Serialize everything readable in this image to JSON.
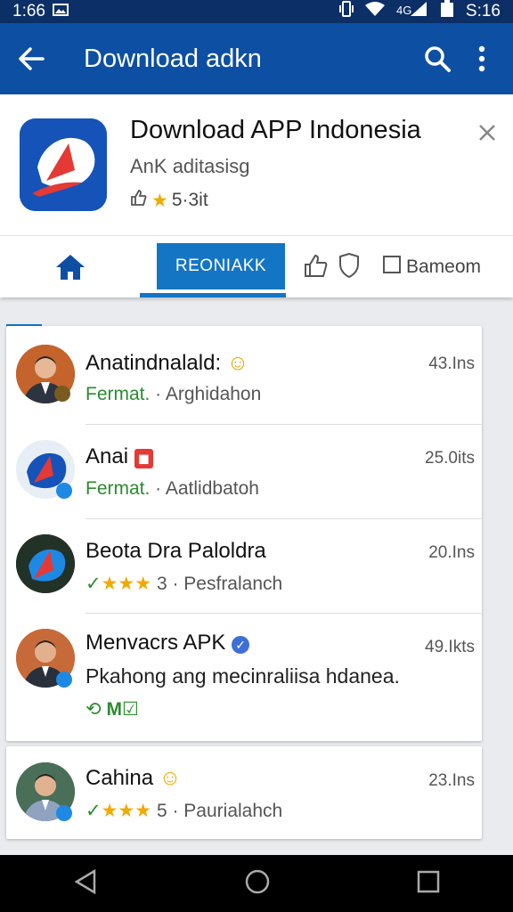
{
  "status": {
    "time": "1:66",
    "right_text": "S:16"
  },
  "appbar": {
    "title": "Download adkn"
  },
  "app": {
    "name": "Download APP Indonesia",
    "subtitle": "AnK aditasisg",
    "rating": "5·3it"
  },
  "tabs": {
    "reco": "REONIAKK",
    "bameom": "Bameom"
  },
  "list": [
    {
      "name": "Anatindnalald:",
      "meta_green": "Fermat.",
      "meta": "Arghidahon",
      "time": "43.Ins"
    },
    {
      "name": "Anai",
      "meta_green": "Fermat.",
      "meta": "Aatlidbatoh",
      "time": "25.0its"
    },
    {
      "name": "Beota Dra Paloldra",
      "stars": "★★★",
      "count": "3",
      "meta": "Pesfralanch",
      "time": "20.Ins"
    },
    {
      "name": "Menvacrs APK",
      "desc": "Pkahong ang mecinraliisa hdanea.",
      "tags": "M",
      "time": "49.Ikts"
    },
    {
      "name": "Cahina",
      "stars": "★★★",
      "count": "5",
      "meta": "Paurialahch",
      "time": "23.Ins"
    }
  ],
  "colors": {
    "primary": "#0d4fa3",
    "accent": "#1475c5",
    "green": "#2c8b2e",
    "star": "#f2a900"
  }
}
